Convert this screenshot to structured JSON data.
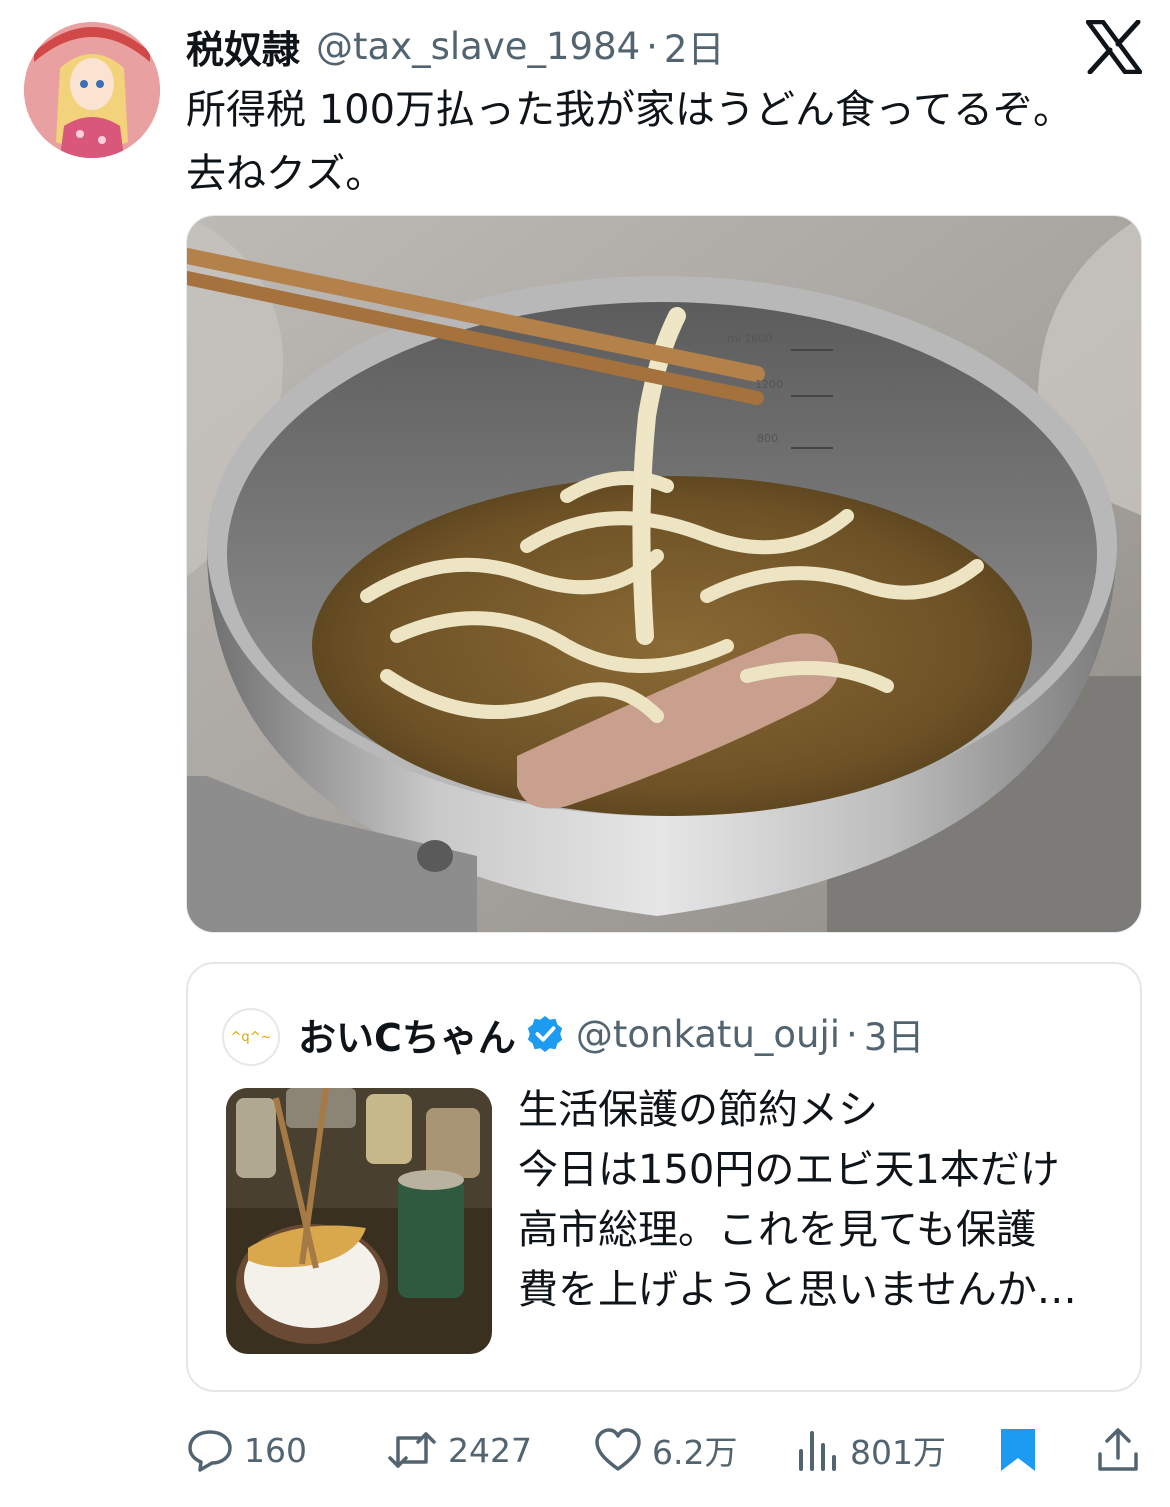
{
  "tweet": {
    "author_name": "税奴隷",
    "handle": "@tax_slave_1984",
    "separator": "·",
    "time": "2日",
    "text_lines": [
      "所得税 100万払った我が家はうどん食ってるぞ。",
      "去ねクズ。"
    ]
  },
  "quote": {
    "author_name": "おいCちゃん",
    "avatar_text": "^q^~",
    "handle": "@tonkatu_ouji",
    "separator": "·",
    "time": "3日",
    "text_lines": [
      "生活保護の節約メシ",
      "今日は150円のエビ天1本だけ",
      "高市総理。これを見ても保護",
      "費を上げようと思いませんか…"
    ]
  },
  "actions": {
    "replies": "160",
    "retweets": "2427",
    "likes": "6.2万",
    "views": "801万"
  },
  "photo": {
    "cup_marks": [
      "ml 1600",
      "1200",
      "800"
    ]
  },
  "colors": {
    "text": "#0f1419",
    "muted": "#536471",
    "accent": "#1d9bf0",
    "verified": "#1d9bf0",
    "bookmark": "#1d9bf0"
  }
}
